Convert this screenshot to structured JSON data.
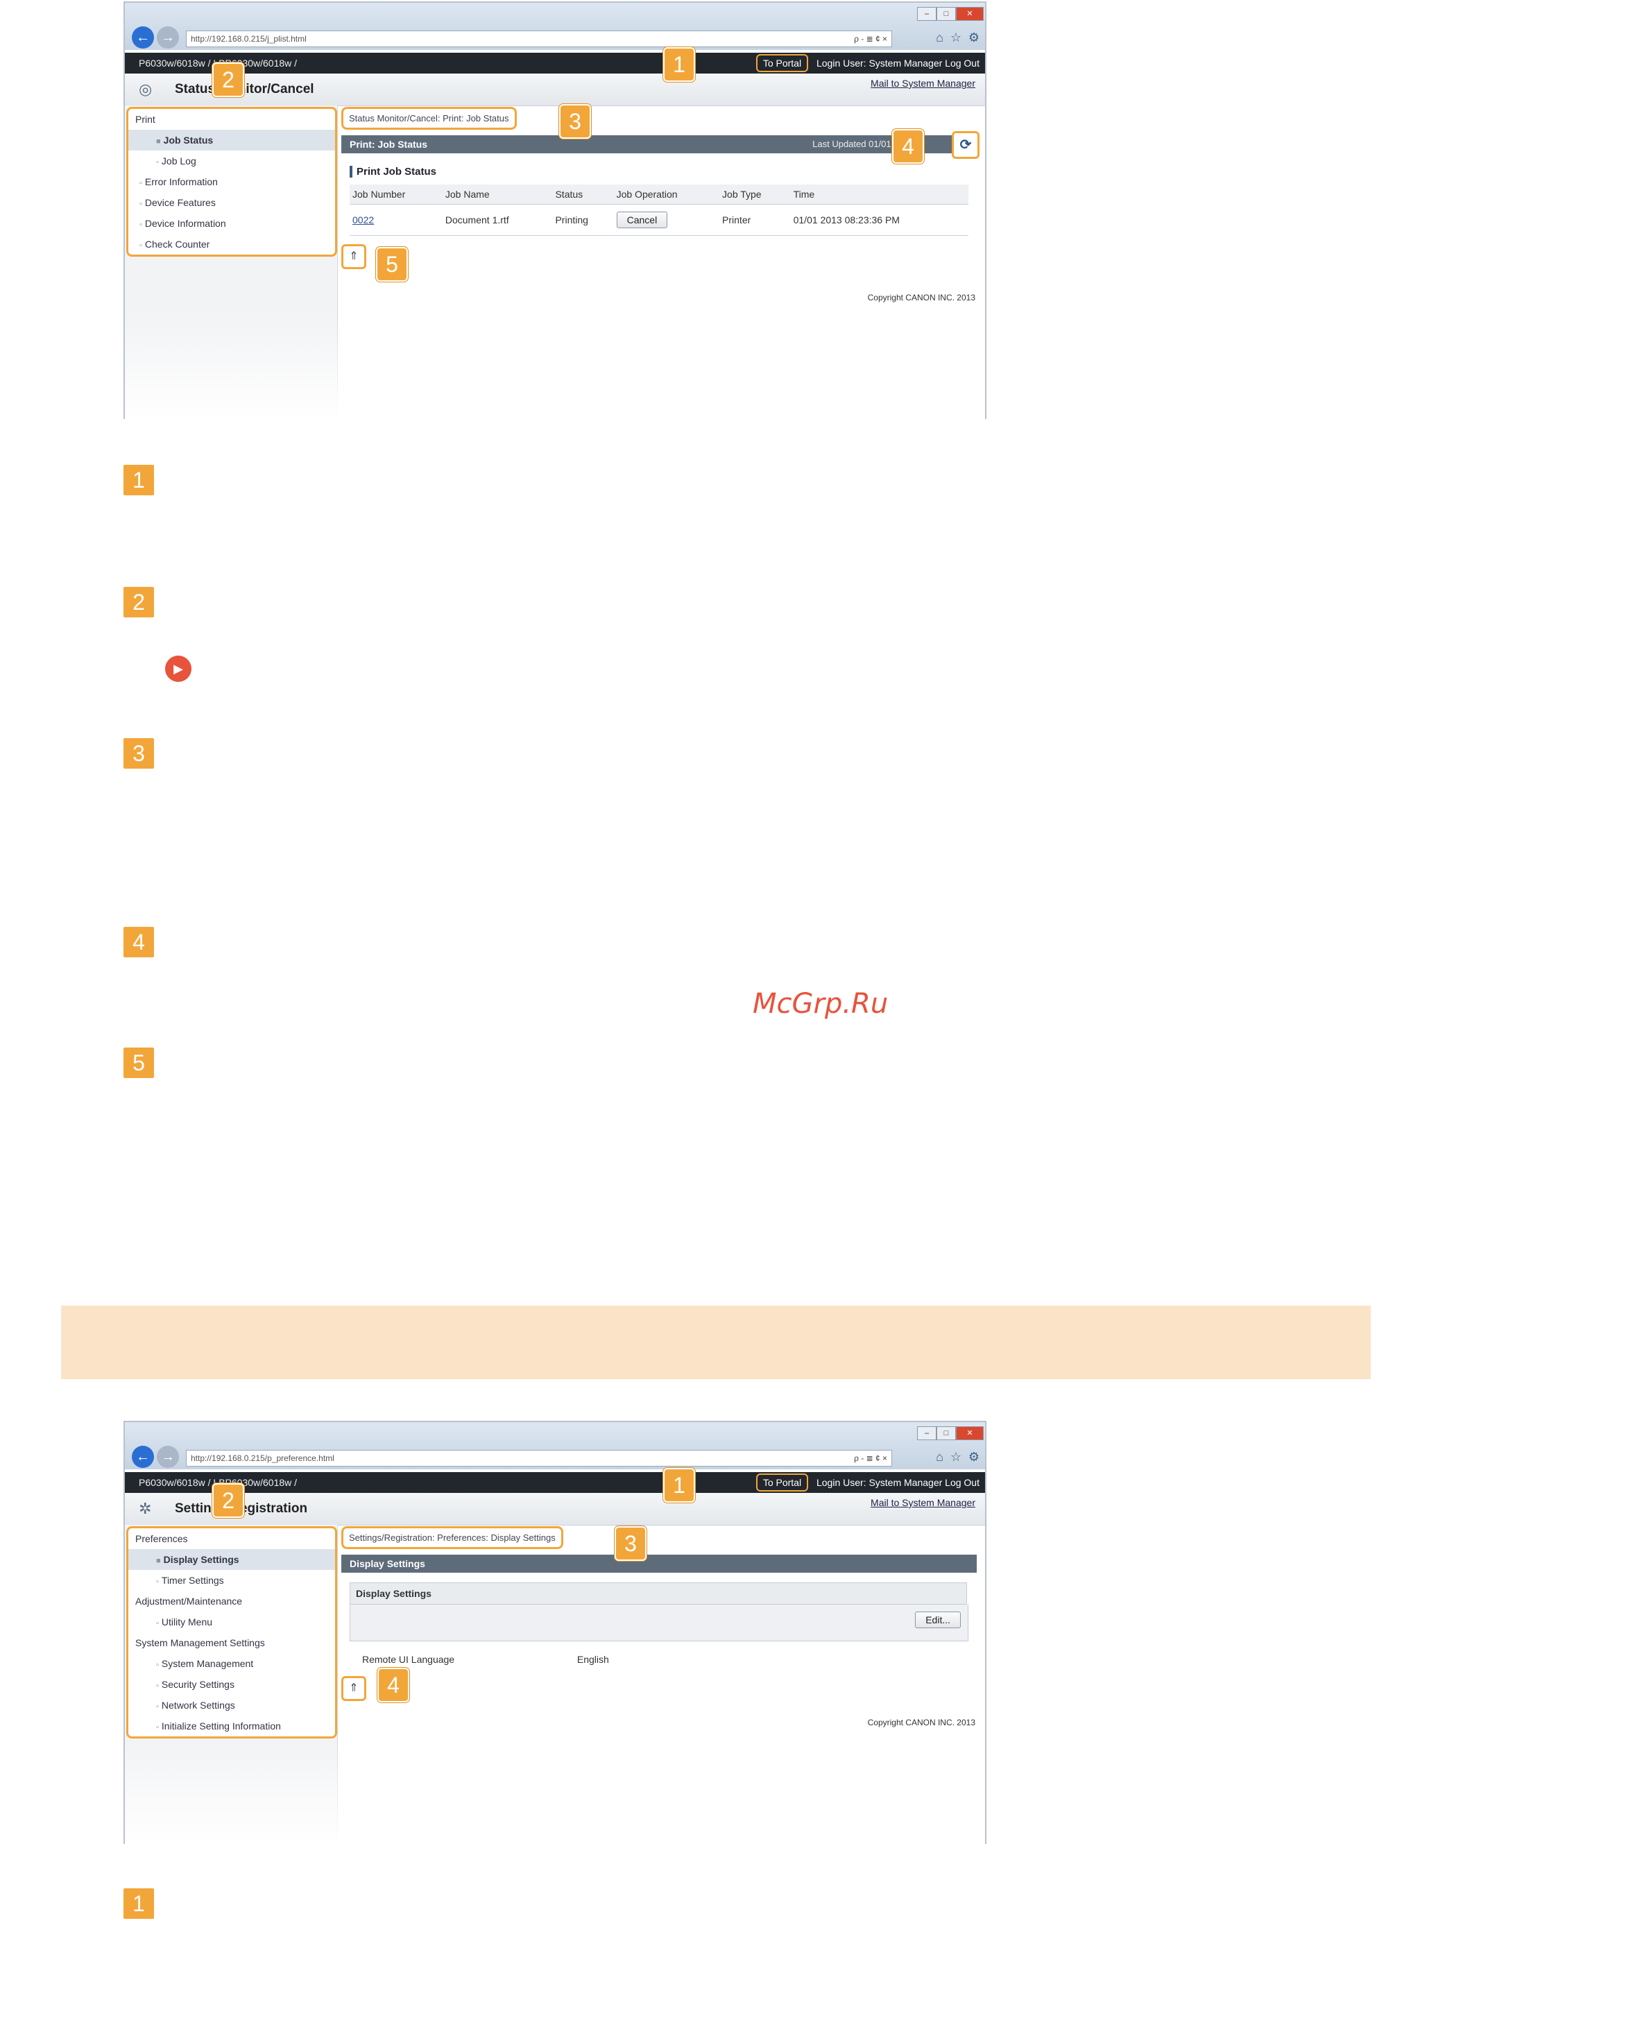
{
  "screenshot1": {
    "address": "http://192.168.0.215/j_plist.html",
    "search_hint": "ρ - ≣ ¢ ×",
    "model": "P6030w/6018w / LBP6030w/6018w /",
    "to_portal": "To Portal",
    "login_user": "Login User: System Manager",
    "log_out": "Log Out",
    "page_title": "Status Monitor/Cancel",
    "mail_link": "Mail to System Manager",
    "menu": [
      {
        "label": "Print",
        "level": "top"
      },
      {
        "label": "Job Status",
        "level": "l2",
        "selected": true
      },
      {
        "label": "Job Log",
        "level": "l2"
      },
      {
        "label": "Error Information",
        "level": "l1"
      },
      {
        "label": "Device Features",
        "level": "l1"
      },
      {
        "label": "Device Information",
        "level": "l1"
      },
      {
        "label": "Check Counter",
        "level": "l1"
      }
    ],
    "breadcrumb": "Status Monitor/Cancel: Print: Job Status",
    "section_title": "Print: Job Status",
    "last_updated": "Last Updated 01/01 2013 0",
    "subheading": "Print Job Status",
    "table": {
      "headers": [
        "Job Number",
        "Job Name",
        "Status",
        "Job Operation",
        "Job Type",
        "Time"
      ],
      "rows": [
        [
          "0022",
          "Document 1.rtf",
          "Printing",
          "Cancel",
          "Printer",
          "01/01 2013 08:23:36 PM"
        ]
      ]
    },
    "copyright": "Copyright CANON INC. 2013"
  },
  "screenshot2": {
    "address": "http://192.168.0.215/p_preference.html",
    "search_hint": "ρ - ≣ ¢ ×",
    "model": "P6030w/6018w / LBP6030w/6018w /",
    "to_portal": "To Portal",
    "login_user": "Login User: System Manager",
    "log_out": "Log Out",
    "page_title": "Settings/Registration",
    "mail_link": "Mail to System Manager",
    "menu": [
      {
        "label": "Preferences",
        "level": "top"
      },
      {
        "label": "Display Settings",
        "level": "l2",
        "selected": true
      },
      {
        "label": "Timer Settings",
        "level": "l2"
      },
      {
        "label": "Adjustment/Maintenance",
        "level": "top"
      },
      {
        "label": "Utility Menu",
        "level": "l2"
      },
      {
        "label": "System Management Settings",
        "level": "top"
      },
      {
        "label": "System Management",
        "level": "l2"
      },
      {
        "label": "Security Settings",
        "level": "l2"
      },
      {
        "label": "Network Settings",
        "level": "l2"
      },
      {
        "label": "Initialize Setting Information",
        "level": "l2"
      }
    ],
    "breadcrumb": "Settings/Registration: Preferences: Display Settings",
    "section_title": "Display Settings",
    "form_title": "Display Settings",
    "edit_button": "Edit...",
    "setting_label": "Remote UI Language",
    "setting_value": "English",
    "copyright": "Copyright CANON INC. 2013"
  },
  "callouts": {
    "one": "1",
    "two": "2",
    "three": "3",
    "four": "4",
    "five": "5"
  },
  "numbers": [
    "1",
    "2",
    "3",
    "4",
    "5"
  ],
  "watermark": "McGrp.Ru",
  "icons": {
    "back": "back-arrow-icon",
    "forward": "forward-arrow-icon",
    "refresh": "refresh-icon",
    "top": "page-top-icon",
    "bullet": "arrow-bullet-icon"
  },
  "colors": {
    "accent": "#f2a63a",
    "banner": "#fbe3c7",
    "bullet": "#e8533b",
    "header": "#22272e"
  }
}
